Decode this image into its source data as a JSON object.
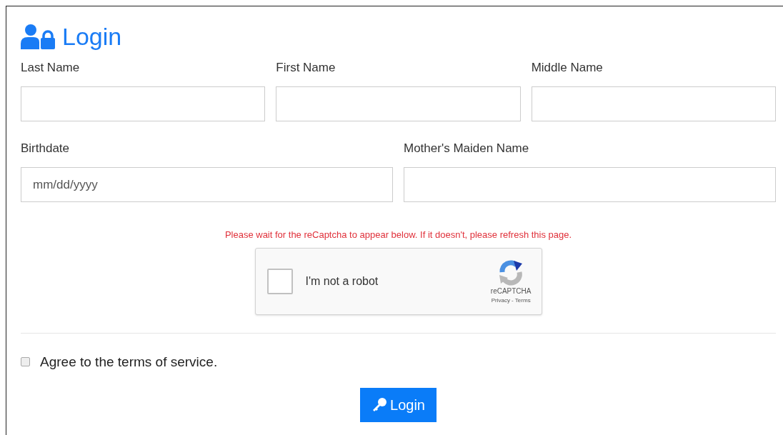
{
  "title": "Login",
  "rows": [
    [
      {
        "label": "Last Name"
      },
      {
        "label": "First Name"
      },
      {
        "label": "Middle Name"
      }
    ],
    [
      {
        "label": "Birthdate",
        "placeholder": "mm/dd/yyyy"
      },
      {
        "label": "Mother's Maiden Name"
      }
    ]
  ],
  "notice": "Please wait for the reCaptcha to appear below. If it doesn't, please refresh this page.",
  "captcha": {
    "label": "I'm not a robot",
    "checked": false,
    "brand": "reCAPTCHA",
    "links": "Privacy - Terms"
  },
  "terms": {
    "label": "Agree to the terms of service.",
    "checked": false
  },
  "button": "Login"
}
